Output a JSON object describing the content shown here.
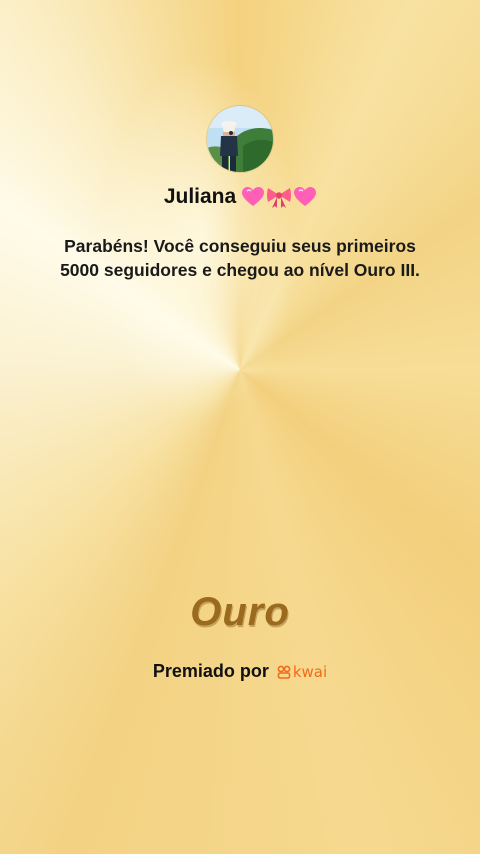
{
  "profile": {
    "username": "Juliana",
    "emojis": [
      "pink-heart-icon",
      "ribbon-icon",
      "pink-heart-icon"
    ]
  },
  "message": "Parabéns! Você conseguiu seus primeiros 5000 seguidores e chegou ao nível Ouro III.",
  "tier": {
    "label": "Ouro"
  },
  "footer": {
    "awarded_by": "Premiado por",
    "brand": "kwai",
    "brand_color": "#f26a1b"
  },
  "colors": {
    "background": "#f6dc8d",
    "tier_text": "#9a6a1f"
  }
}
